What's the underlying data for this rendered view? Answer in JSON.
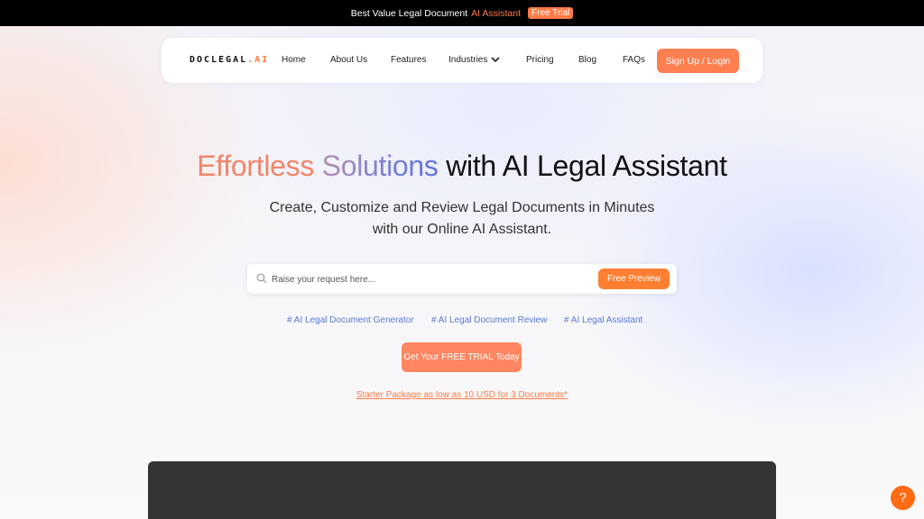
{
  "announcement": {
    "text": "Best Value Legal Document",
    "accent": "AI Assistant",
    "badge": "Free Trial"
  },
  "nav": {
    "logo": "DOCLEGAL",
    "logo_suffix": ".AI",
    "items": [
      "Home",
      "About Us",
      "Features",
      "Industries",
      "Pricing",
      "Blog",
      "FAQs"
    ],
    "signup_label": "Sign Up / Login"
  },
  "hero": {
    "title_part1": "Effortless",
    "title_part2": "Solutions",
    "title_part3": "with AI Legal Assistant",
    "subtitle_line1": "Create, Customize and Review Legal Documents in Minutes",
    "subtitle_line2": "with our Online AI Assistant."
  },
  "search": {
    "placeholder": "Raise your request here...",
    "button_label": "Free Preview"
  },
  "tags": [
    "# AI Legal Document Generator",
    "# AI Legal Document Review",
    "# AI Legal Assistant"
  ],
  "cta": {
    "label": "Get Your FREE TRIAL Today",
    "starter_link": "Starter Package as low as 10 USD for 3 Documents*"
  },
  "help": {
    "label": "?"
  },
  "colors": {
    "accent": "#ff7a45",
    "button": "#ff7f50",
    "tag_link": "#5b78d4",
    "topbar": "#000000",
    "video_placeholder": "#333333"
  },
  "icons": {
    "search": "search-icon",
    "dropdown": "chevron-down-icon",
    "help": "help-icon"
  }
}
